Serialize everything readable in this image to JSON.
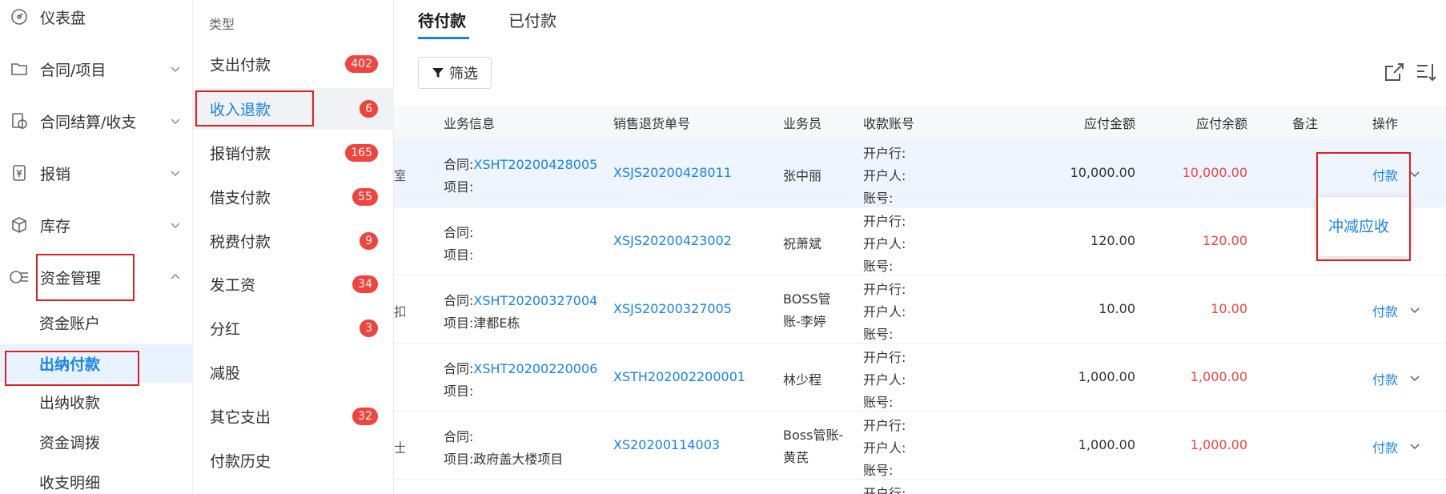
{
  "nav": {
    "dashboard": "仪表盘",
    "contract": "合同/项目",
    "settlement": "合同结算/收支",
    "reimburse": "报销",
    "inventory": "库存",
    "funds": "资金管理",
    "sub": [
      "资金账户",
      "出纳付款",
      "出纳收款",
      "资金调拨",
      "收支明细"
    ]
  },
  "types": {
    "header": "类型",
    "items": [
      {
        "label": "支出付款",
        "badge": "402"
      },
      {
        "label": "收入退款",
        "badge": "6"
      },
      {
        "label": "报销付款",
        "badge": "165"
      },
      {
        "label": "借支付款",
        "badge": "55"
      },
      {
        "label": "税费付款",
        "badge": "9"
      },
      {
        "label": "发工资",
        "badge": "34"
      },
      {
        "label": "分红",
        "badge": "3"
      },
      {
        "label": "减股",
        "badge": ""
      },
      {
        "label": "其它支出",
        "badge": "32"
      },
      {
        "label": "付款历史",
        "badge": ""
      }
    ]
  },
  "tabs": [
    "待付款",
    "已付款"
  ],
  "filter_label": "筛选",
  "table": {
    "headers": [
      "业务信息",
      "销售退货单号",
      "业务员",
      "收款账号",
      "应付金额",
      "应付余额",
      "备注",
      "操作"
    ],
    "rows": [
      {
        "clip": "室",
        "contract_prefix": "合同:",
        "contract": "XSHT20200428005",
        "project": "项目:",
        "order": "XSJS20200428011",
        "staff1": "张中丽",
        "staff2": "",
        "acct": [
          "开户行:",
          "开户人:",
          "账号:"
        ],
        "amount": "10,000.00",
        "balance": "10,000.00",
        "action": "付款"
      },
      {
        "clip": "",
        "contract_prefix": "合同:",
        "contract": "",
        "project": "项目:",
        "order": "XSJS20200423002",
        "staff1": "祝萧斌",
        "staff2": "",
        "acct": [
          "开户行:",
          "开户人:",
          "账号:"
        ],
        "amount": "120.00",
        "balance": "120.00",
        "action": ""
      },
      {
        "clip": "扣",
        "contract_prefix": "合同:",
        "contract": "XSHT20200327004",
        "project": "项目:津都E栋",
        "order": "XSJS20200327005",
        "staff1": "BOSS管",
        "staff2": "账-李婷",
        "acct": [
          "开户行:",
          "开户人:",
          "账号:"
        ],
        "amount": "10.00",
        "balance": "10.00",
        "action": "付款"
      },
      {
        "clip": "",
        "contract_prefix": "合同:",
        "contract": "XSHT20200220006",
        "project": "项目:",
        "order": "XSTH202002200001",
        "staff1": "林少程",
        "staff2": "",
        "acct": [
          "开户行:",
          "开户人:",
          "账号:"
        ],
        "amount": "1,000.00",
        "balance": "1,000.00",
        "action": "付款"
      },
      {
        "clip": "士",
        "contract_prefix": "合同:",
        "contract": "",
        "project": "项目:政府盖大楼项目",
        "order": "XS20200114003",
        "staff1": "Boss管账-",
        "staff2": "黄芪",
        "acct": [
          "开户行:",
          "开户人:",
          "账号:"
        ],
        "amount": "1,000.00",
        "balance": "1,000.00",
        "action": "付款"
      }
    ],
    "partial_row_acct": "开户行:"
  },
  "dropdown_item": "冲减应收",
  "colors": {
    "accent": "#1683e9",
    "danger": "#f0443f",
    "highlight_box": "#e02020"
  }
}
